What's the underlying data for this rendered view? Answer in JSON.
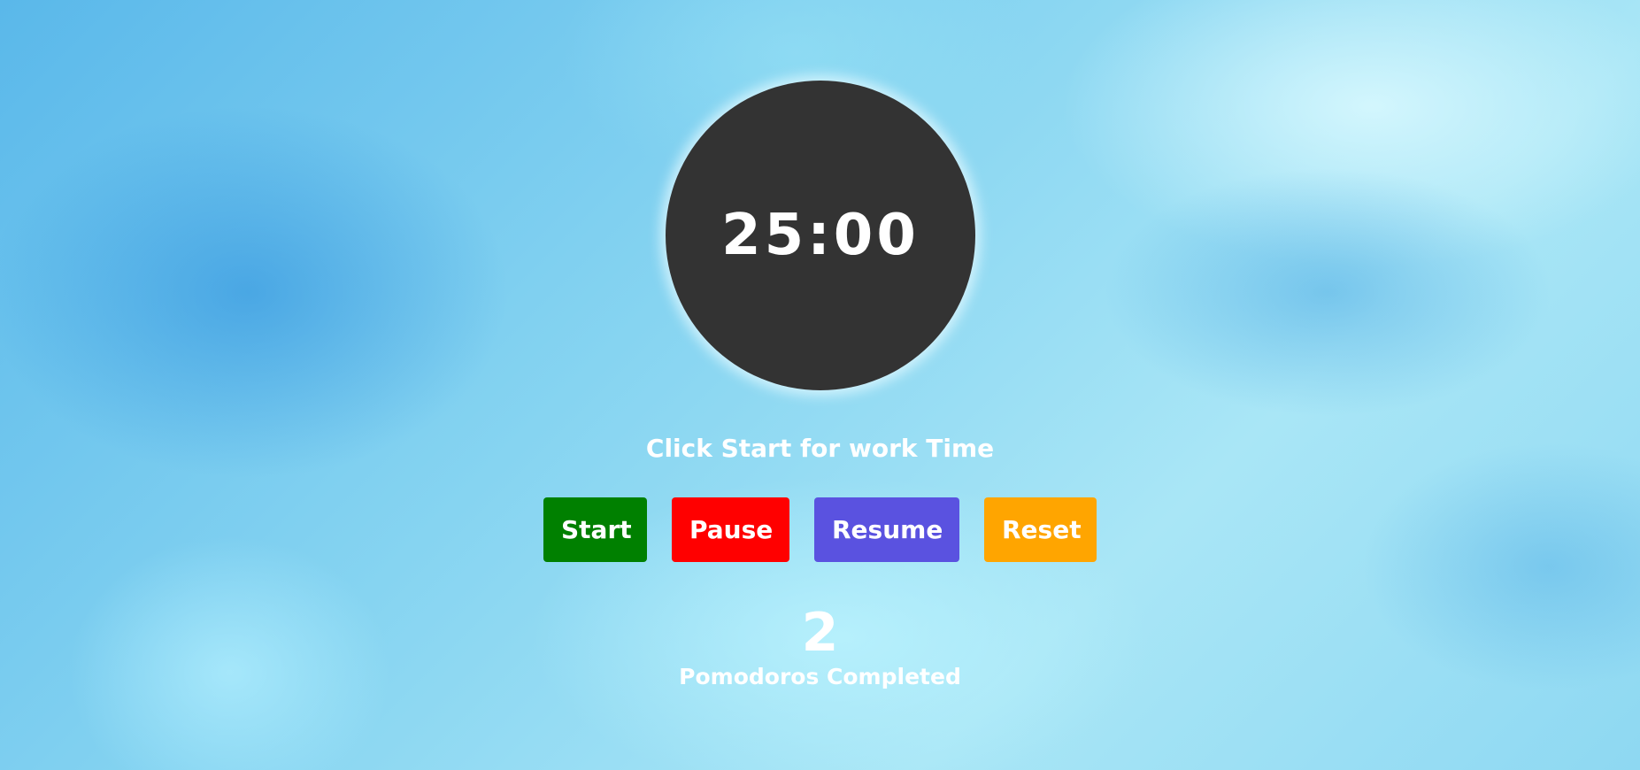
{
  "timer": {
    "display": "25:00"
  },
  "status": {
    "message": "Click Start for work Time"
  },
  "controls": {
    "start_label": "Start",
    "pause_label": "Pause",
    "resume_label": "Resume",
    "reset_label": "Reset"
  },
  "counter": {
    "value": "2",
    "label": "Pomodoros Completed"
  },
  "colors": {
    "timer_bg": "#333333",
    "start": "#008000",
    "pause": "#ff0000",
    "resume": "#5a52e0",
    "reset": "#ffa500",
    "text": "#ffffff"
  }
}
